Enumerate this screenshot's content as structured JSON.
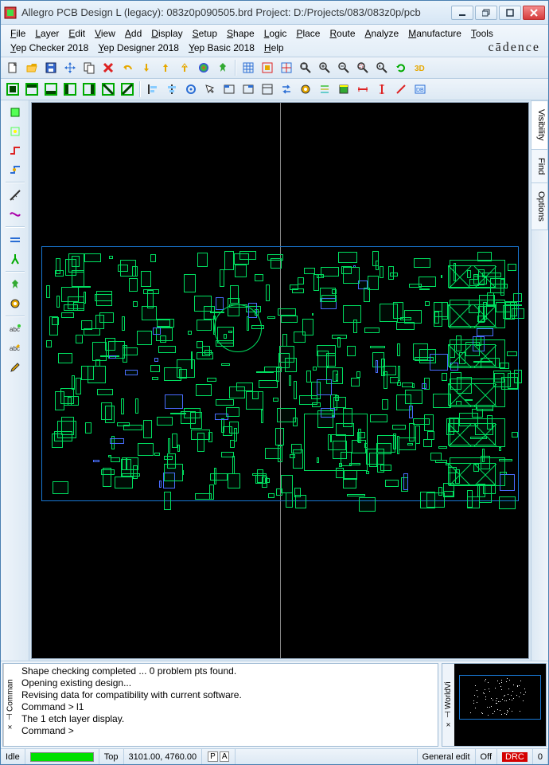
{
  "title": "Allegro PCB Design L (legacy): 083z0p090505.brd   Project: D:/Projects/083/083z0p/pcb",
  "menu": [
    "File",
    "Layer",
    "Edit",
    "View",
    "Add",
    "Display",
    "Setup",
    "Shape",
    "Logic",
    "Place",
    "Route",
    "Analyze",
    "Manufacture",
    "Tools",
    "Yep Checker 2018",
    "Yep Designer 2018",
    "Yep Basic 2018",
    "Help"
  ],
  "brand": "cādence",
  "right_tabs": [
    "Visibility",
    "Find",
    "Options"
  ],
  "console_label": "Comman",
  "console_lines": [
    "Shape checking completed ... 0 problem pts found.",
    "Opening existing design...",
    "Revising data for compatibility with current software.",
    "Command > l1",
    "The 1 etch layer display.",
    "Command >"
  ],
  "worldview_label": "WorldVi",
  "status": {
    "state": "Idle",
    "layer": "Top",
    "coords": "3101.00, 4760.00",
    "p": "P",
    "a": "A",
    "mode": "General edit",
    "onoff": "Off",
    "drc": "DRC",
    "count": "0"
  },
  "toolbar1_tips": [
    "new",
    "open",
    "save",
    "move-tool",
    "copy-tool",
    "delete",
    "undo",
    "redo-down",
    "redo-up",
    "redo-hollow",
    "color",
    "pin",
    "sep",
    "grid",
    "highlight",
    "cross-probe",
    "zoom-fit",
    "zoom-in",
    "zoom-out",
    "zoom-window",
    "zoom-prev",
    "refresh",
    "3d-view"
  ],
  "toolbar2_tips": [
    "layer-all",
    "layer-top",
    "layer-bot",
    "layer-gnd",
    "layer-pwr",
    "layer-1",
    "layer-2",
    "sep",
    "align-left",
    "align-center-h",
    "align-right",
    "select",
    "tab-left",
    "tab-right",
    "panel",
    "swap",
    "via",
    "stackup",
    "film",
    "dim-h",
    "dim-v",
    "dim-diag",
    "odb"
  ],
  "vtool_tips": [
    "place",
    "place-manual",
    "route",
    "route-edit",
    "sep",
    "measure",
    "tline",
    "sep",
    "diffpair",
    "split",
    "sep",
    "pin",
    "via",
    "sep",
    "text-abc",
    "text-abc-edit",
    "edit-pen"
  ]
}
